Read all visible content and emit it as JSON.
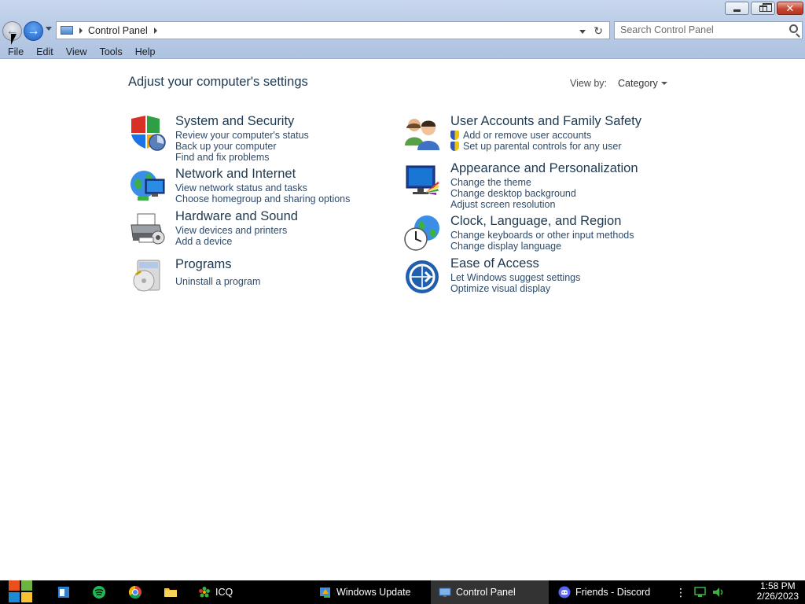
{
  "window": {
    "minimize_label": "Minimize",
    "maximize_label": "Restore",
    "close_label": "Close"
  },
  "address": {
    "path": "Control Panel"
  },
  "search": {
    "placeholder": "Search Control Panel"
  },
  "menu": {
    "items": [
      "File",
      "Edit",
      "View",
      "Tools",
      "Help"
    ]
  },
  "content": {
    "title": "Adjust your computer's settings",
    "view_by_label": "View by:",
    "view_by_value": "Category",
    "categories": [
      {
        "title": "System and Security",
        "icon": "shield-icon",
        "links": [
          "Review your computer's status",
          "Back up your computer",
          "Find and fix problems"
        ]
      },
      {
        "title": "Network and Internet",
        "icon": "network-globe-icon",
        "links": [
          "View network status and tasks",
          "Choose homegroup and sharing options"
        ]
      },
      {
        "title": "Hardware and Sound",
        "icon": "printer-icon",
        "links": [
          "View devices and printers",
          "Add a device"
        ]
      },
      {
        "title": "Programs",
        "icon": "programs-disc-icon",
        "links": [
          "Uninstall a program"
        ]
      },
      {
        "title": "User Accounts and Family Safety",
        "icon": "users-icon",
        "links": [
          "Add or remove user accounts",
          "Set up parental controls for any user"
        ]
      },
      {
        "title": "Appearance and Personalization",
        "icon": "monitor-palette-icon",
        "links": [
          "Change the theme",
          "Change desktop background",
          "Adjust screen resolution"
        ]
      },
      {
        "title": "Clock, Language, and Region",
        "icon": "clock-globe-icon",
        "links": [
          "Change keyboards or other input methods",
          "Change display language"
        ]
      },
      {
        "title": "Ease of Access",
        "icon": "ease-of-access-icon",
        "links": [
          "Let Windows suggest settings",
          "Optimize visual display"
        ]
      }
    ]
  },
  "taskbar": {
    "tasks": [
      {
        "label": "ICQ",
        "icon": "icq-flower-icon"
      },
      {
        "label": "Windows Update",
        "icon": "windows-update-icon"
      },
      {
        "label": "Control Panel",
        "icon": "control-panel-icon"
      },
      {
        "label": "Friends - Discord",
        "icon": "discord-icon"
      }
    ],
    "time": "1:58 PM",
    "date": "2/26/2023"
  },
  "colors": {
    "chrome": "#b9cbe6",
    "accent": "#1c5fc6",
    "link": "#2f4b6a",
    "heading": "#1e3950"
  }
}
